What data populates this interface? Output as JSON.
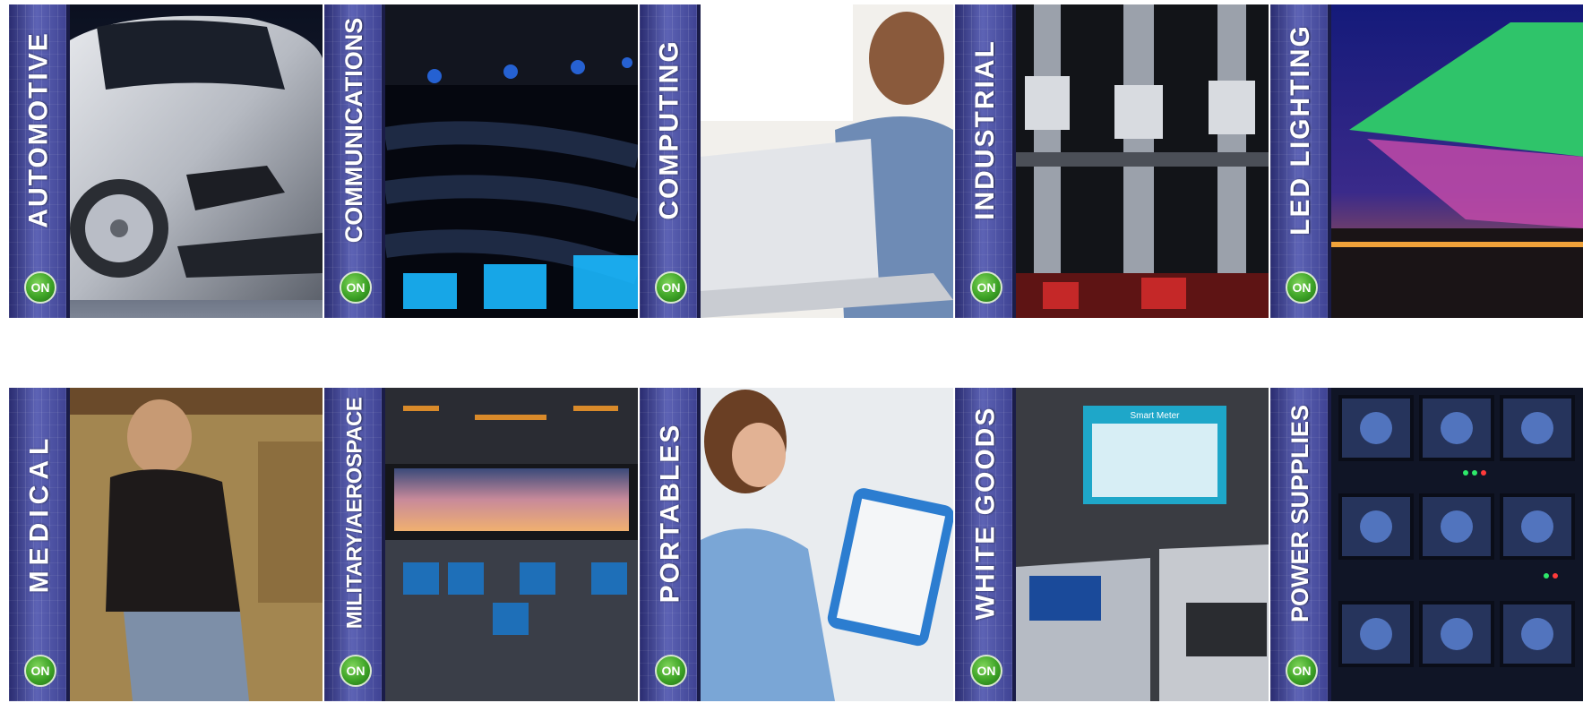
{
  "brand": {
    "logo_text": "ON"
  },
  "rows": [
    {
      "tiles": [
        {
          "label": "AUTOMOTIVE",
          "logo": "ON"
        },
        {
          "label": "COMMUNICATIONS",
          "logo": "ON"
        },
        {
          "label": "COMPUTING",
          "logo": "ON"
        },
        {
          "label": "INDUSTRIAL",
          "logo": "ON"
        },
        {
          "label": "LED LIGHTING",
          "logo": "ON"
        }
      ]
    },
    {
      "tiles": [
        {
          "label": "MEDICAL",
          "logo": "ON"
        },
        {
          "label": "MILITARY/AEROSPACE",
          "logo": "ON"
        },
        {
          "label": "PORTABLES",
          "logo": "ON"
        },
        {
          "label": "WHITE GOODS",
          "logo": "ON"
        },
        {
          "label": "POWER SUPPLIES",
          "logo": "ON"
        }
      ]
    }
  ],
  "photos": {
    "white_goods_screen": {
      "title": "Smart Meter"
    }
  },
  "colors": {
    "band": "#3b3f8f",
    "logo_green": "#3da326"
  }
}
